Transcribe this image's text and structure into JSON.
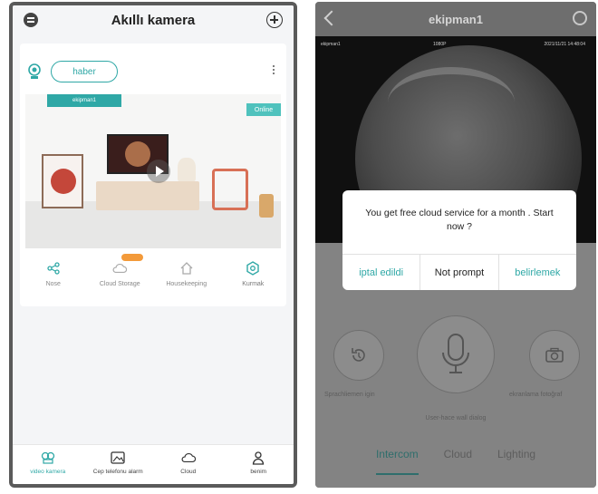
{
  "left": {
    "header": {
      "title": "Akıllı kamera"
    },
    "card": {
      "haber_label": "haber",
      "device_tag": "ekipman1",
      "status_badge": "Online",
      "actions": [
        {
          "label": "Nose",
          "icon": "share-icon"
        },
        {
          "label": "Cloud Storage",
          "icon": "cloud-icon",
          "badge": ""
        },
        {
          "label": "Housekeeping",
          "icon": "home-icon"
        },
        {
          "label": "Kurmak",
          "icon": "gear-icon"
        }
      ]
    },
    "bottom_nav": [
      {
        "label": "video kamera",
        "icon": "camera-icon",
        "active": true
      },
      {
        "label": "Cep telefonu alarm",
        "icon": "image-icon",
        "active": false
      },
      {
        "label": "Cloud",
        "icon": "cloud-icon",
        "active": false
      },
      {
        "label": "benim",
        "icon": "person-icon",
        "active": false
      }
    ],
    "colors": {
      "accent": "#2fa8a6"
    }
  },
  "right": {
    "header": {
      "title": "ekipman1"
    },
    "video": {
      "osd_left": "ekipman1",
      "osd_mid": "1080P",
      "osd_right": "2021/11/21 14:48:04"
    },
    "dialog": {
      "message": "You get free cloud service for a month . Start now ?",
      "buttons": [
        {
          "label": "iptal edildi",
          "accent": true
        },
        {
          "label": "Not prompt",
          "accent": false
        },
        {
          "label": "belirlemek",
          "accent": true
        }
      ]
    },
    "controls": {
      "left_label": "Sprachliemen igin",
      "right_label": "ekranlama fotoğraf",
      "mic_hint": "User-hace wall dialog"
    },
    "tabs": [
      {
        "label": "Intercom",
        "active": true
      },
      {
        "label": "Cloud",
        "active": false
      },
      {
        "label": "Lighting",
        "active": false
      }
    ]
  }
}
